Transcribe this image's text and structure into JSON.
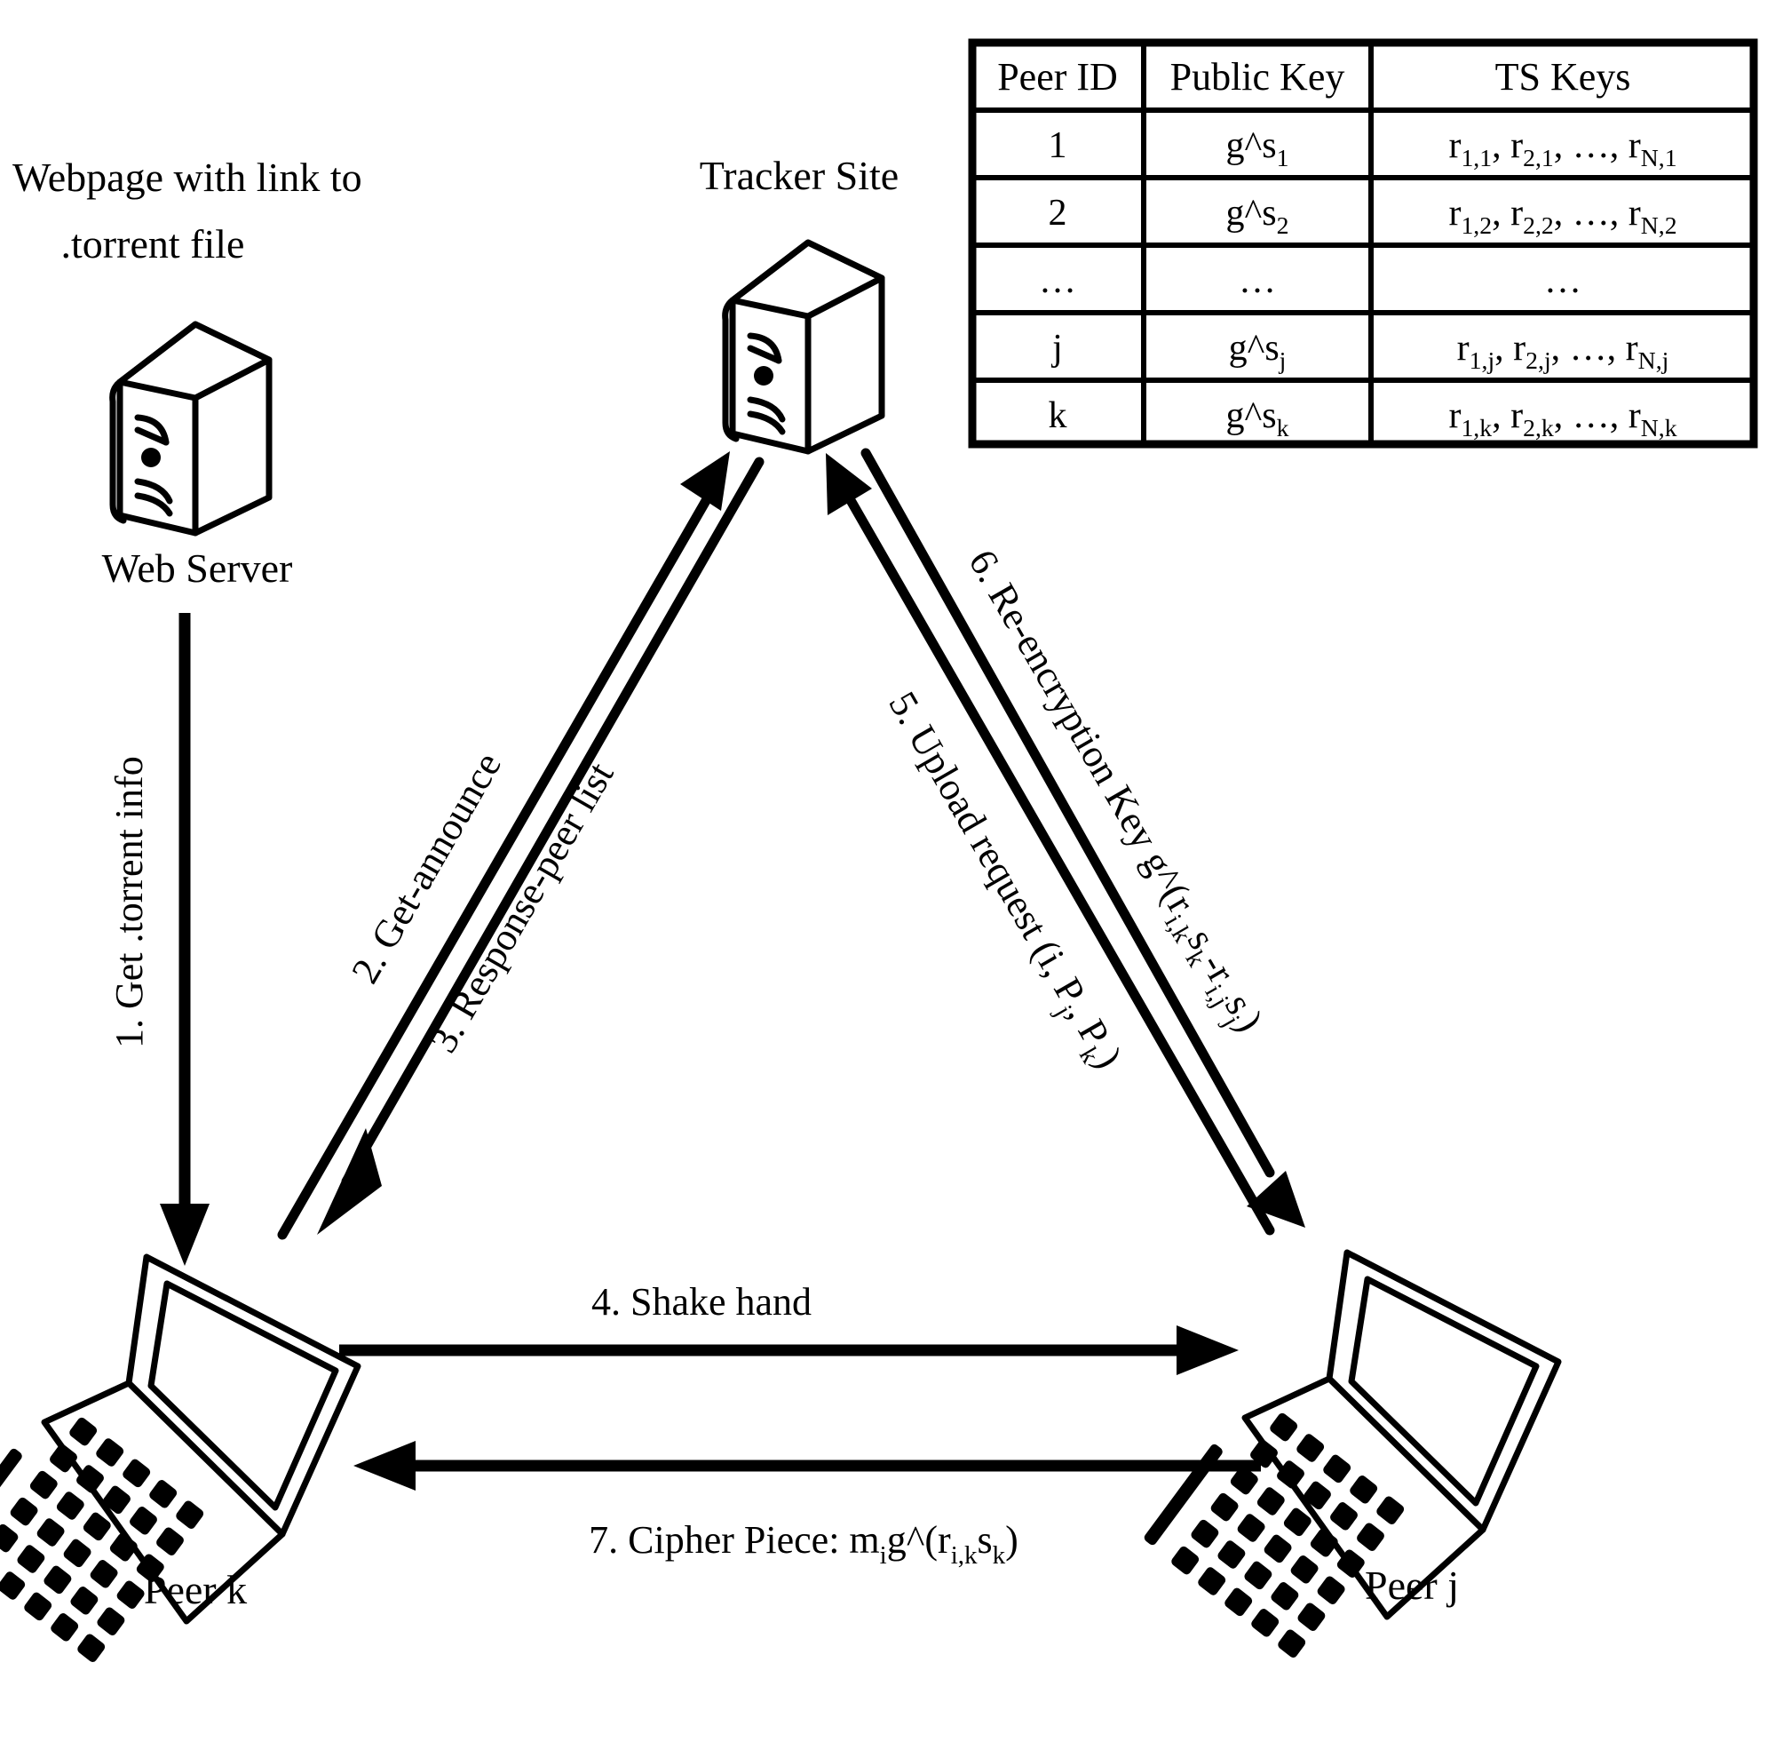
{
  "nodes": {
    "web_server": {
      "caption_line1": "Webpage with link to",
      "caption_line2": ".torrent file",
      "label": "Web Server",
      "icon": "server-icon"
    },
    "tracker": {
      "label": "Tracker Site",
      "icon": "server-icon"
    },
    "peer_k": {
      "label": "Peer k",
      "icon": "laptop-icon"
    },
    "peer_j": {
      "label": "Peer j",
      "icon": "laptop-icon"
    }
  },
  "steps": [
    {
      "id": "step-1",
      "text": "1. Get .torrent info"
    },
    {
      "id": "step-2",
      "text": "2. Get-announce"
    },
    {
      "id": "step-3",
      "text": "3. Response-peer list"
    },
    {
      "id": "step-4",
      "text": "4. Shake hand"
    },
    {
      "id": "step-5",
      "prefix": "5. Upload request (i, P",
      "sub1": "j",
      "mid": ", P",
      "sub2": "k",
      "suffix": ")"
    },
    {
      "id": "step-6",
      "prefix": "6. Re-encryption Key g^(r",
      "sub1": "i,k",
      "mid1": "s",
      "sub2": "k",
      "mid2": "-r",
      "sub3": "i,j",
      "mid3": "s",
      "sub4": "j",
      "suffix": ")"
    },
    {
      "id": "step-7",
      "prefix": "7. Cipher Piece: m",
      "sub1": "i",
      "mid1": "g^(r",
      "sub2": "i,k",
      "mid2": "s",
      "sub3": "k",
      "suffix": ")"
    }
  ],
  "table": {
    "headers": [
      "Peer ID",
      "Public Key",
      "TS Keys"
    ],
    "rows": [
      {
        "peer_id": "1",
        "public_key": {
          "base": "g^s",
          "sub": "1"
        },
        "ts_keys": [
          {
            "base": "r",
            "sub": "1,1"
          },
          {
            "base": "r",
            "sub": "2,1"
          },
          {
            "base": "…",
            "sub": ""
          },
          {
            "base": "r",
            "sub": "N,1"
          }
        ]
      },
      {
        "peer_id": "2",
        "public_key": {
          "base": "g^s",
          "sub": "2"
        },
        "ts_keys": [
          {
            "base": "r",
            "sub": "1,2"
          },
          {
            "base": "r",
            "sub": "2,2"
          },
          {
            "base": "…",
            "sub": ""
          },
          {
            "base": "r",
            "sub": "N,2"
          }
        ]
      },
      {
        "peer_id": "…",
        "public_key": {
          "base": "…",
          "sub": ""
        },
        "ts_keys": [
          {
            "base": "…",
            "sub": ""
          }
        ]
      },
      {
        "peer_id": "j",
        "public_key": {
          "base": "g^s",
          "sub": "j"
        },
        "ts_keys": [
          {
            "base": "r",
            "sub": "1,j"
          },
          {
            "base": "r",
            "sub": "2,j"
          },
          {
            "base": "…",
            "sub": ""
          },
          {
            "base": "r",
            "sub": "N,j"
          }
        ]
      },
      {
        "peer_id": "k",
        "public_key": {
          "base": "g^s",
          "sub": "k"
        },
        "ts_keys": [
          {
            "base": "r",
            "sub": "1,k"
          },
          {
            "base": "r",
            "sub": "2,k"
          },
          {
            "base": "…",
            "sub": ""
          },
          {
            "base": "r",
            "sub": "N,k"
          }
        ]
      }
    ]
  },
  "colors": {
    "ink": "#000000",
    "paper": "#ffffff"
  }
}
